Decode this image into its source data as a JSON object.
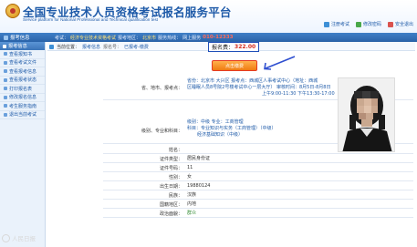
{
  "header": {
    "title": "全国专业技术人员资格考试报名服务平台",
    "subtitle": "Service platform for National Professional and Technical qualification test",
    "links": [
      {
        "label": "注册考试",
        "icon": "user-icon"
      },
      {
        "label": "修改密码",
        "icon": "lock-icon"
      },
      {
        "label": "安全退出",
        "icon": "exit-icon"
      }
    ]
  },
  "topbar": {
    "user_label": "报考信息",
    "info_prefix": "考试：",
    "exam_name": "经济专业技术资格考试",
    "province_label": "报考地区：",
    "province": "北京市",
    "phone_label": "服务热线：",
    "phone_prefix": "网上服务",
    "phone": "010-12333"
  },
  "sidebar": {
    "head": "报考信息",
    "items": [
      "查看报知书",
      "查看考试文件",
      "查看报考信息",
      "查看报考状态",
      "打印报名表",
      "修改报名信息",
      "考生服务指南",
      "退出当前考试"
    ]
  },
  "crumb": {
    "prefix": "当前位置：",
    "section": "报考信息",
    "sep": "  报名号：",
    "status_label": "已报考-缴费"
  },
  "fee": {
    "label": "报名费：",
    "amount": "322.00"
  },
  "pay_button": "点击缴费",
  "form": {
    "rows": [
      {
        "label": "",
        "lines": [
          "省份：北京市  大兴区  报考点：西城区人事考试中心（地址：西城",
          "区睡眠人员8号院2号楼考试中心一层大厅） 审核时间：8月5日-8月8日",
          "上午9:00-11:30 下午13:30-17:00"
        ],
        "color": "blue"
      },
      {
        "label": "省、地市、报考点：",
        "lines": [],
        "color": "blue"
      },
      {
        "label": "级别、专业和科目：",
        "lines": [
          "级别：中级  专业：工商管理",
          "科目：专业知识与实务（工商管理）（中级）",
          "经济基础知识（中级）"
        ],
        "color": "blue"
      },
      {
        "label": "姓名：",
        "lines": [
          ""
        ],
        "color": "black"
      },
      {
        "label": "证件类型：",
        "lines": [
          "居民身份证"
        ],
        "color": "black"
      },
      {
        "label": "证件号码：",
        "lines": [
          "11"
        ],
        "color": "black"
      },
      {
        "label": "性别：",
        "lines": [
          "女"
        ],
        "color": "black"
      },
      {
        "label": "出生日期：",
        "lines": [
          "19880124"
        ],
        "color": "black"
      },
      {
        "label": "民族：",
        "lines": [
          "汉族"
        ],
        "color": "black"
      },
      {
        "label": "国籍地区：",
        "lines": [
          "内地"
        ],
        "color": "black"
      },
      {
        "label": "政治面貌：",
        "lines": [
          "群众"
        ],
        "color": "green"
      }
    ]
  },
  "watermark": "人民日报"
}
